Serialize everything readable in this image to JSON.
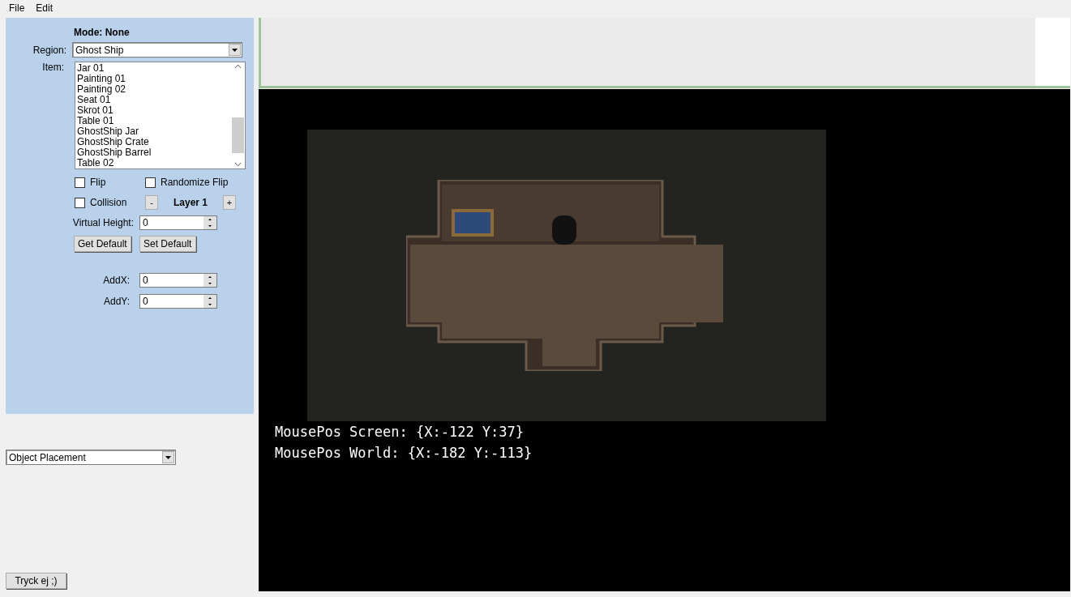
{
  "menu": [
    "File",
    "Edit"
  ],
  "panel": {
    "mode": "Mode: None",
    "region": {
      "label": "Region:",
      "value": "Ghost Ship"
    },
    "item": {
      "label": "Item:",
      "options": [
        {
          "label": "Jar 01",
          "selected": false
        },
        {
          "label": "Painting 01",
          "selected": false
        },
        {
          "label": "Painting 02",
          "selected": false
        },
        {
          "label": "Seat 01",
          "selected": false
        },
        {
          "label": "Skrot 01",
          "selected": false
        },
        {
          "label": "Table 01",
          "selected": false
        },
        {
          "label": "GhostShip Jar",
          "selected": false
        },
        {
          "label": "GhostShip Crate",
          "selected": false
        },
        {
          "label": "GhostShip Barrel",
          "selected": false
        },
        {
          "label": "Table 02",
          "selected": false
        }
      ]
    },
    "flip": {
      "label": "Flip",
      "checked": false
    },
    "randomize_flip": {
      "label": "Randomize Flip",
      "checked": false
    },
    "collision": {
      "label": "Collision",
      "checked": false
    },
    "layer": {
      "minus": "-",
      "label": "Layer 1",
      "plus": "+"
    },
    "virtual_height": {
      "label": "Virtual Height:",
      "value": "0"
    },
    "buttons": [
      "Get Default",
      "Set Default"
    ],
    "add_x": {
      "label": "AddX:",
      "value": "0"
    },
    "add_y": {
      "label": "AddY:",
      "value": "0"
    }
  },
  "mode_select": {
    "value": "Object Placement"
  },
  "bottom_button": "Tryck ej ;)",
  "viewport": {
    "lines": [
      "MousePos Screen: {X:-122 Y:37}",
      "MousePos World: {X:-182 Y:-113}"
    ]
  }
}
